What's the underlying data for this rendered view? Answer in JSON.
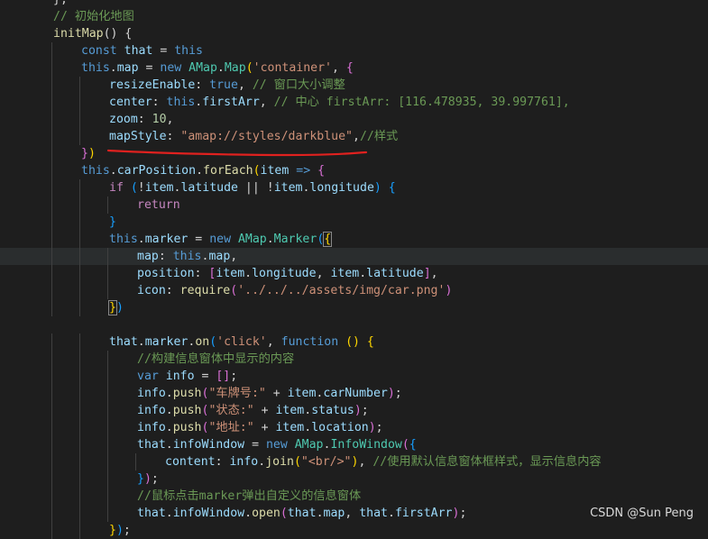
{
  "lines": [
    [
      {
        "t": "},",
        "c": "tok-p"
      }
    ],
    [
      {
        "t": "// 初始化地图",
        "c": "tok-cmt"
      }
    ],
    [
      {
        "t": "initMap",
        "c": "tok-fn"
      },
      {
        "t": "() {",
        "c": "tok-p"
      }
    ],
    [
      {
        "t": "const ",
        "c": "tok-kw"
      },
      {
        "t": "that",
        "c": "tok-var"
      },
      {
        "t": " = ",
        "c": "tok-p"
      },
      {
        "t": "this",
        "c": "tok-kw"
      }
    ],
    [
      {
        "t": "this",
        "c": "tok-kw"
      },
      {
        "t": ".",
        "c": "tok-p"
      },
      {
        "t": "map",
        "c": "tok-var"
      },
      {
        "t": " = ",
        "c": "tok-p"
      },
      {
        "t": "new ",
        "c": "tok-kw"
      },
      {
        "t": "AMap",
        "c": "tok-cls"
      },
      {
        "t": ".",
        "c": "tok-p"
      },
      {
        "t": "Map",
        "c": "tok-cls"
      },
      {
        "t": "(",
        "c": "tok-b1"
      },
      {
        "t": "'container'",
        "c": "tok-str"
      },
      {
        "t": ", ",
        "c": "tok-p"
      },
      {
        "t": "{",
        "c": "tok-b2"
      }
    ],
    [
      {
        "t": "resizeEnable",
        "c": "tok-var"
      },
      {
        "t": ": ",
        "c": "tok-p"
      },
      {
        "t": "true",
        "c": "tok-kw"
      },
      {
        "t": ", ",
        "c": "tok-p"
      },
      {
        "t": "// 窗口大小调整",
        "c": "tok-cmt"
      }
    ],
    [
      {
        "t": "center",
        "c": "tok-var"
      },
      {
        "t": ": ",
        "c": "tok-p"
      },
      {
        "t": "this",
        "c": "tok-kw"
      },
      {
        "t": ".",
        "c": "tok-p"
      },
      {
        "t": "firstArr",
        "c": "tok-var"
      },
      {
        "t": ", ",
        "c": "tok-p"
      },
      {
        "t": "// 中心 firstArr: [116.478935, 39.997761],",
        "c": "tok-cmt"
      }
    ],
    [
      {
        "t": "zoom",
        "c": "tok-var"
      },
      {
        "t": ": ",
        "c": "tok-p"
      },
      {
        "t": "10",
        "c": "tok-num"
      },
      {
        "t": ",",
        "c": "tok-p"
      }
    ],
    [
      {
        "t": "mapStyle",
        "c": "tok-var"
      },
      {
        "t": ": ",
        "c": "tok-p"
      },
      {
        "t": "\"amap://styles/darkblue\"",
        "c": "tok-str"
      },
      {
        "t": ",",
        "c": "tok-p"
      },
      {
        "t": "//样式",
        "c": "tok-cmt"
      }
    ],
    [
      {
        "t": "}",
        "c": "tok-b2"
      },
      {
        "t": ")",
        "c": "tok-b1"
      }
    ],
    [
      {
        "t": "this",
        "c": "tok-kw"
      },
      {
        "t": ".",
        "c": "tok-p"
      },
      {
        "t": "carPosition",
        "c": "tok-var"
      },
      {
        "t": ".",
        "c": "tok-p"
      },
      {
        "t": "forEach",
        "c": "tok-fn"
      },
      {
        "t": "(",
        "c": "tok-b1"
      },
      {
        "t": "item",
        "c": "tok-var"
      },
      {
        "t": " => ",
        "c": "tok-kw"
      },
      {
        "t": "{",
        "c": "tok-b2"
      }
    ],
    [
      {
        "t": "if ",
        "c": "tok-ctl"
      },
      {
        "t": "(",
        "c": "tok-b3"
      },
      {
        "t": "!",
        "c": "tok-p"
      },
      {
        "t": "item",
        "c": "tok-var"
      },
      {
        "t": ".",
        "c": "tok-p"
      },
      {
        "t": "latitude",
        "c": "tok-var"
      },
      {
        "t": " || ",
        "c": "tok-p"
      },
      {
        "t": "!",
        "c": "tok-p"
      },
      {
        "t": "item",
        "c": "tok-var"
      },
      {
        "t": ".",
        "c": "tok-p"
      },
      {
        "t": "longitude",
        "c": "tok-var"
      },
      {
        "t": ") ",
        "c": "tok-b3"
      },
      {
        "t": "{",
        "c": "tok-b3"
      }
    ],
    [
      {
        "t": "return",
        "c": "tok-ctl"
      }
    ],
    [
      {
        "t": "}",
        "c": "tok-b3"
      }
    ],
    [
      {
        "t": "this",
        "c": "tok-kw"
      },
      {
        "t": ".",
        "c": "tok-p"
      },
      {
        "t": "marker",
        "c": "tok-var"
      },
      {
        "t": " = ",
        "c": "tok-p"
      },
      {
        "t": "new ",
        "c": "tok-kw"
      },
      {
        "t": "AMap",
        "c": "tok-cls"
      },
      {
        "t": ".",
        "c": "tok-p"
      },
      {
        "t": "Marker",
        "c": "tok-cls"
      },
      {
        "t": "(",
        "c": "tok-b3"
      },
      {
        "t": "{",
        "c": "tok-b1",
        "box": true
      }
    ],
    [
      {
        "t": "map",
        "c": "tok-var"
      },
      {
        "t": ": ",
        "c": "tok-p"
      },
      {
        "t": "this",
        "c": "tok-kw"
      },
      {
        "t": ".",
        "c": "tok-p"
      },
      {
        "t": "map",
        "c": "tok-var"
      },
      {
        "t": ",",
        "c": "tok-p"
      }
    ],
    [
      {
        "t": "position",
        "c": "tok-var"
      },
      {
        "t": ": ",
        "c": "tok-p"
      },
      {
        "t": "[",
        "c": "tok-b2"
      },
      {
        "t": "item",
        "c": "tok-var"
      },
      {
        "t": ".",
        "c": "tok-p"
      },
      {
        "t": "longitude",
        "c": "tok-var"
      },
      {
        "t": ", ",
        "c": "tok-p"
      },
      {
        "t": "item",
        "c": "tok-var"
      },
      {
        "t": ".",
        "c": "tok-p"
      },
      {
        "t": "latitude",
        "c": "tok-var"
      },
      {
        "t": "]",
        "c": "tok-b2"
      },
      {
        "t": ",",
        "c": "tok-p"
      }
    ],
    [
      {
        "t": "icon",
        "c": "tok-var"
      },
      {
        "t": ": ",
        "c": "tok-p"
      },
      {
        "t": "require",
        "c": "tok-fn"
      },
      {
        "t": "(",
        "c": "tok-b2"
      },
      {
        "t": "'../../../assets/img/car.png'",
        "c": "tok-str"
      },
      {
        "t": ")",
        "c": "tok-b2"
      }
    ],
    [
      {
        "t": "}",
        "c": "tok-b1",
        "box": true
      },
      {
        "t": ")",
        "c": "tok-b3"
      }
    ],
    [],
    [
      {
        "t": "that",
        "c": "tok-var"
      },
      {
        "t": ".",
        "c": "tok-p"
      },
      {
        "t": "marker",
        "c": "tok-var"
      },
      {
        "t": ".",
        "c": "tok-p"
      },
      {
        "t": "on",
        "c": "tok-fn"
      },
      {
        "t": "(",
        "c": "tok-b3"
      },
      {
        "t": "'click'",
        "c": "tok-str"
      },
      {
        "t": ", ",
        "c": "tok-p"
      },
      {
        "t": "function ",
        "c": "tok-kw"
      },
      {
        "t": "() ",
        "c": "tok-b1"
      },
      {
        "t": "{",
        "c": "tok-b1"
      }
    ],
    [
      {
        "t": "//构建信息窗体中显示的内容",
        "c": "tok-cmt"
      }
    ],
    [
      {
        "t": "var ",
        "c": "tok-kw"
      },
      {
        "t": "info",
        "c": "tok-var"
      },
      {
        "t": " = ",
        "c": "tok-p"
      },
      {
        "t": "[]",
        "c": "tok-b2"
      },
      {
        "t": ";",
        "c": "tok-p"
      }
    ],
    [
      {
        "t": "info",
        "c": "tok-var"
      },
      {
        "t": ".",
        "c": "tok-p"
      },
      {
        "t": "push",
        "c": "tok-fn"
      },
      {
        "t": "(",
        "c": "tok-b2"
      },
      {
        "t": "\"车牌号:\"",
        "c": "tok-str"
      },
      {
        "t": " + ",
        "c": "tok-p"
      },
      {
        "t": "item",
        "c": "tok-var"
      },
      {
        "t": ".",
        "c": "tok-p"
      },
      {
        "t": "carNumber",
        "c": "tok-var"
      },
      {
        "t": ")",
        "c": "tok-b2"
      },
      {
        "t": ";",
        "c": "tok-p"
      }
    ],
    [
      {
        "t": "info",
        "c": "tok-var"
      },
      {
        "t": ".",
        "c": "tok-p"
      },
      {
        "t": "push",
        "c": "tok-fn"
      },
      {
        "t": "(",
        "c": "tok-b2"
      },
      {
        "t": "\"状态:\"",
        "c": "tok-str"
      },
      {
        "t": " + ",
        "c": "tok-p"
      },
      {
        "t": "item",
        "c": "tok-var"
      },
      {
        "t": ".",
        "c": "tok-p"
      },
      {
        "t": "status",
        "c": "tok-var"
      },
      {
        "t": ")",
        "c": "tok-b2"
      },
      {
        "t": ";",
        "c": "tok-p"
      }
    ],
    [
      {
        "t": "info",
        "c": "tok-var"
      },
      {
        "t": ".",
        "c": "tok-p"
      },
      {
        "t": "push",
        "c": "tok-fn"
      },
      {
        "t": "(",
        "c": "tok-b2"
      },
      {
        "t": "\"地址:\"",
        "c": "tok-str"
      },
      {
        "t": " + ",
        "c": "tok-p"
      },
      {
        "t": "item",
        "c": "tok-var"
      },
      {
        "t": ".",
        "c": "tok-p"
      },
      {
        "t": "location",
        "c": "tok-var"
      },
      {
        "t": ")",
        "c": "tok-b2"
      },
      {
        "t": ";",
        "c": "tok-p"
      }
    ],
    [
      {
        "t": "that",
        "c": "tok-var"
      },
      {
        "t": ".",
        "c": "tok-p"
      },
      {
        "t": "infoWindow",
        "c": "tok-var"
      },
      {
        "t": " = ",
        "c": "tok-p"
      },
      {
        "t": "new ",
        "c": "tok-kw"
      },
      {
        "t": "AMap",
        "c": "tok-cls"
      },
      {
        "t": ".",
        "c": "tok-p"
      },
      {
        "t": "InfoWindow",
        "c": "tok-cls"
      },
      {
        "t": "(",
        "c": "tok-b2"
      },
      {
        "t": "{",
        "c": "tok-b3"
      }
    ],
    [
      {
        "t": "content",
        "c": "tok-var"
      },
      {
        "t": ": ",
        "c": "tok-p"
      },
      {
        "t": "info",
        "c": "tok-var"
      },
      {
        "t": ".",
        "c": "tok-p"
      },
      {
        "t": "join",
        "c": "tok-fn"
      },
      {
        "t": "(",
        "c": "tok-b1"
      },
      {
        "t": "\"<br/>\"",
        "c": "tok-str"
      },
      {
        "t": ")",
        "c": "tok-b1"
      },
      {
        "t": ", ",
        "c": "tok-p"
      },
      {
        "t": "//使用默认信息窗体框样式，显示信息内容",
        "c": "tok-cmt"
      }
    ],
    [
      {
        "t": "}",
        "c": "tok-b3"
      },
      {
        "t": ")",
        "c": "tok-b2"
      },
      {
        "t": ";",
        "c": "tok-p"
      }
    ],
    [
      {
        "t": "//鼠标点击marker弹出自定义的信息窗体",
        "c": "tok-cmt"
      }
    ],
    [
      {
        "t": "that",
        "c": "tok-var"
      },
      {
        "t": ".",
        "c": "tok-p"
      },
      {
        "t": "infoWindow",
        "c": "tok-var"
      },
      {
        "t": ".",
        "c": "tok-p"
      },
      {
        "t": "open",
        "c": "tok-fn"
      },
      {
        "t": "(",
        "c": "tok-b2"
      },
      {
        "t": "that",
        "c": "tok-var"
      },
      {
        "t": ".",
        "c": "tok-p"
      },
      {
        "t": "map",
        "c": "tok-var"
      },
      {
        "t": ", ",
        "c": "tok-p"
      },
      {
        "t": "that",
        "c": "tok-var"
      },
      {
        "t": ".",
        "c": "tok-p"
      },
      {
        "t": "firstArr",
        "c": "tok-var"
      },
      {
        "t": ")",
        "c": "tok-b2"
      },
      {
        "t": ";",
        "c": "tok-p"
      }
    ],
    [
      {
        "t": "}",
        "c": "tok-b1"
      },
      {
        "t": ")",
        "c": "tok-b3"
      },
      {
        "t": ";",
        "c": "tok-p"
      }
    ]
  ],
  "watermark": "CSDN @Sun  Peng",
  "colors": {
    "background": "#1e1e1e",
    "current_line": "#2a2d2e",
    "annotation_underline": "#e0211f"
  }
}
